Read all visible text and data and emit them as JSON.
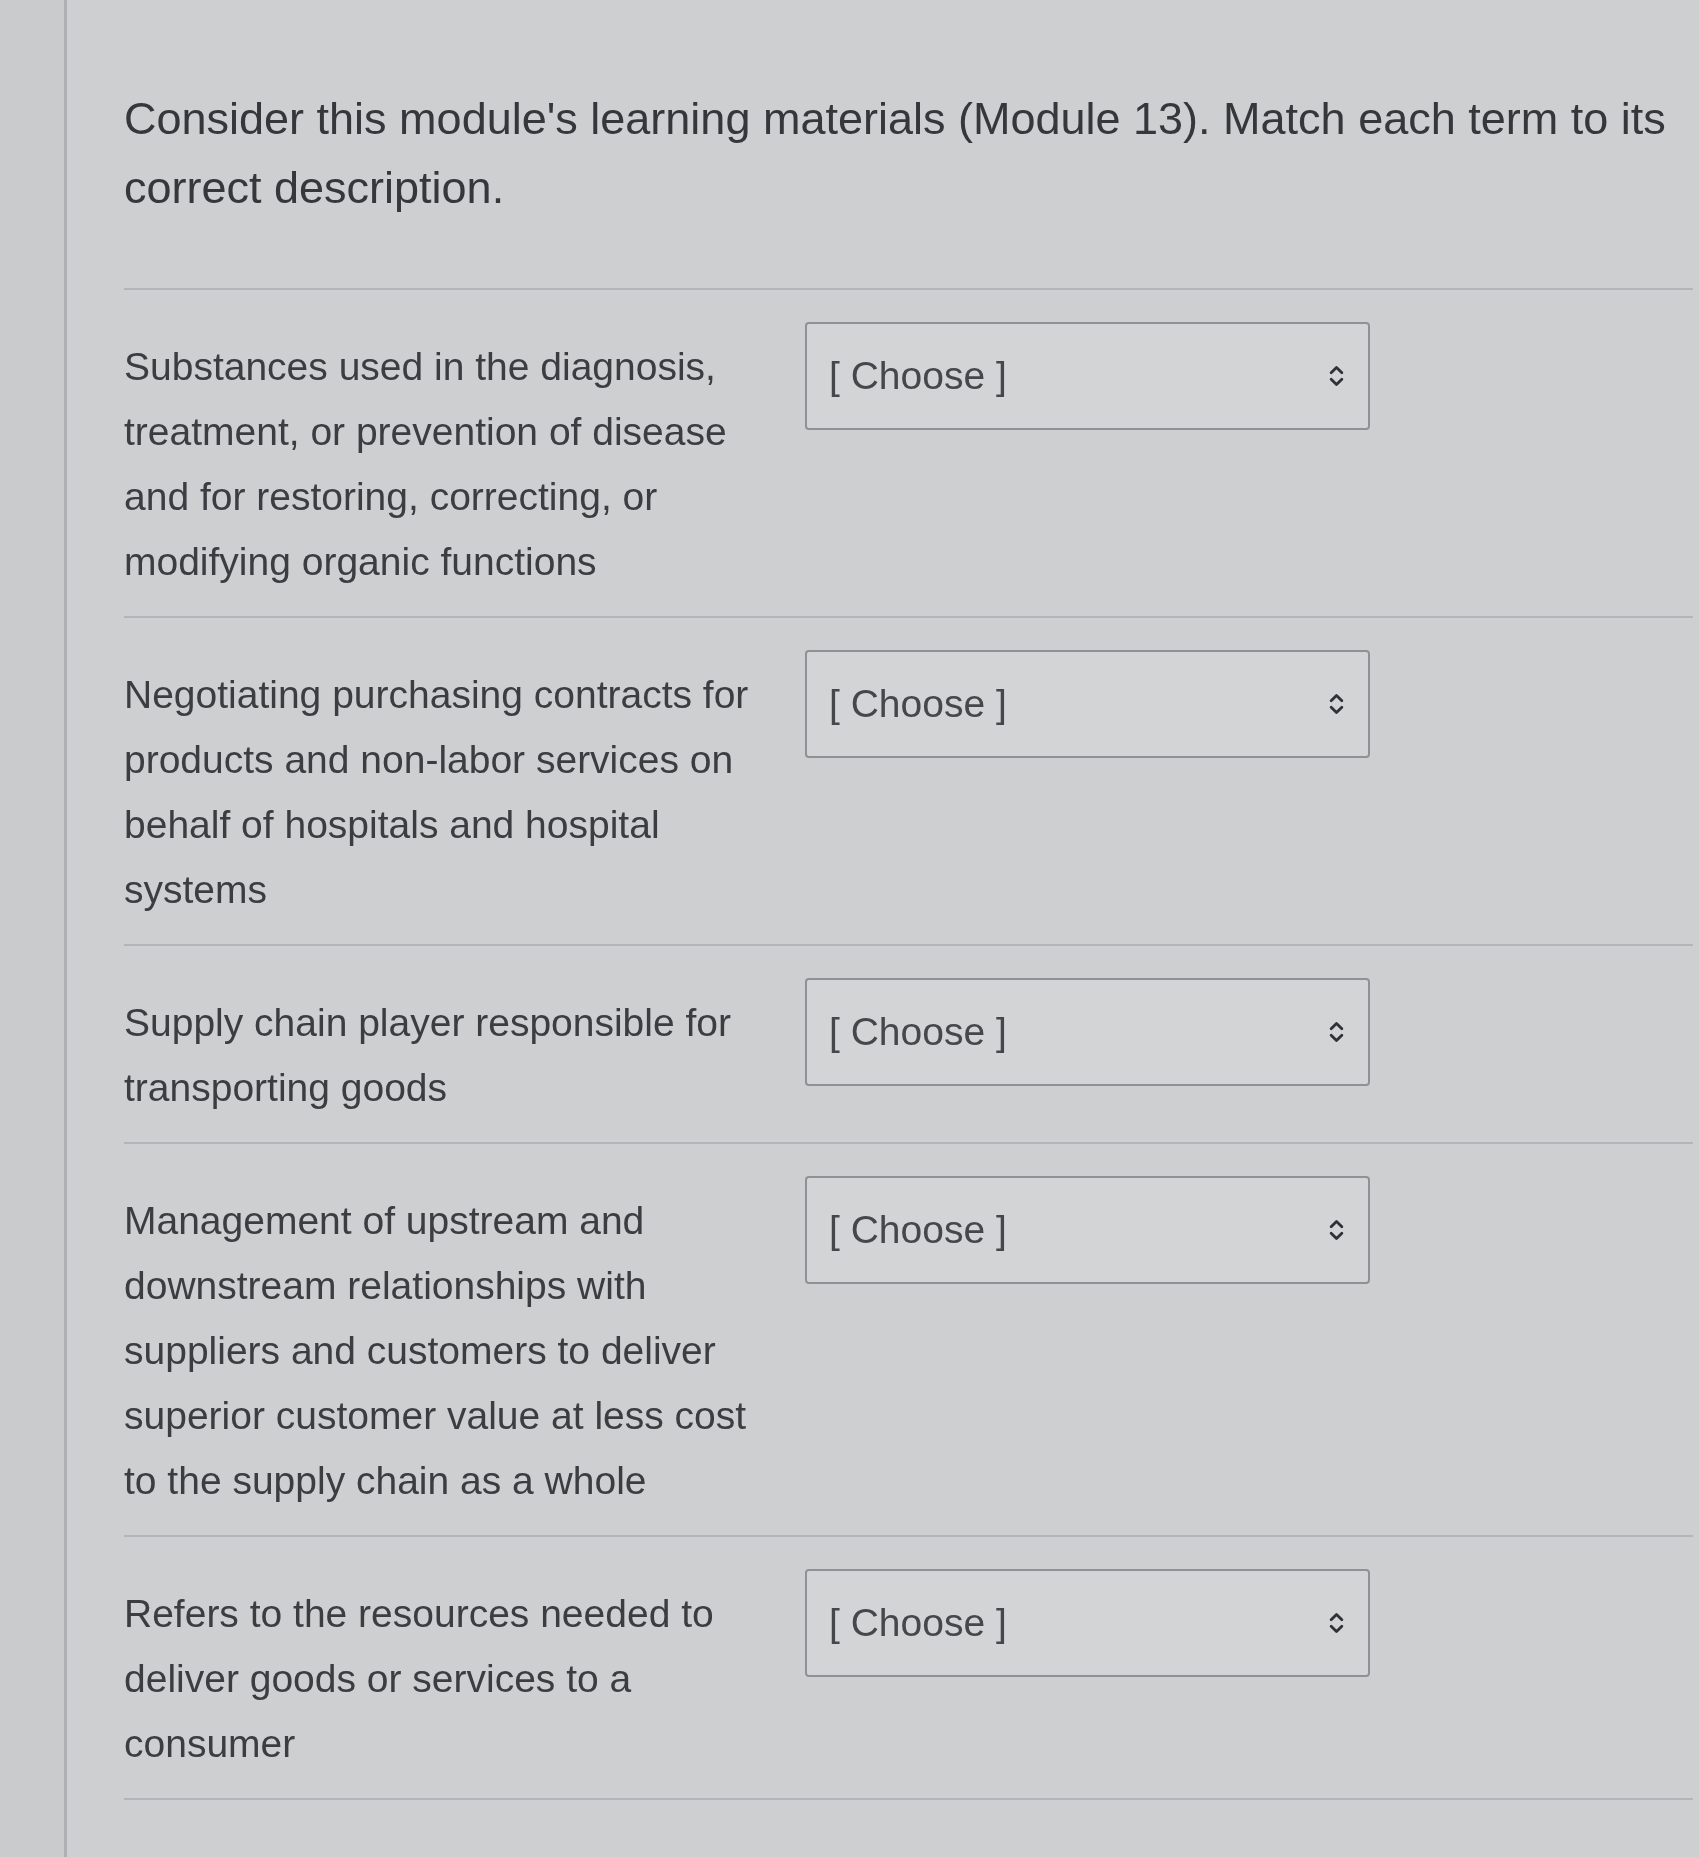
{
  "question": "Consider this module's learning materials (Module 13). Match each term to its correct description.",
  "pairs": [
    {
      "description": "Substances used in the diagnosis, treatment, or prevention of disease and for restoring, correcting, or modifying organic functions",
      "dropdown": {
        "value": "[ Choose ]"
      }
    },
    {
      "description": "Negotiating purchasing contracts for products and non-labor services on behalf of hospitals and hospital systems",
      "dropdown": {
        "value": "[ Choose ]"
      }
    },
    {
      "description": "Supply chain player responsible for transporting goods",
      "dropdown": {
        "value": "[ Choose ]"
      }
    },
    {
      "description": "Management of upstream and downstream relationships with suppliers and customers to deliver superior customer value at less cost to the supply chain as a whole",
      "dropdown": {
        "value": "[ Choose ]"
      }
    },
    {
      "description": "Refers to the resources needed to deliver goods or services to a consumer",
      "dropdown": {
        "value": "[ Choose ]"
      }
    }
  ]
}
